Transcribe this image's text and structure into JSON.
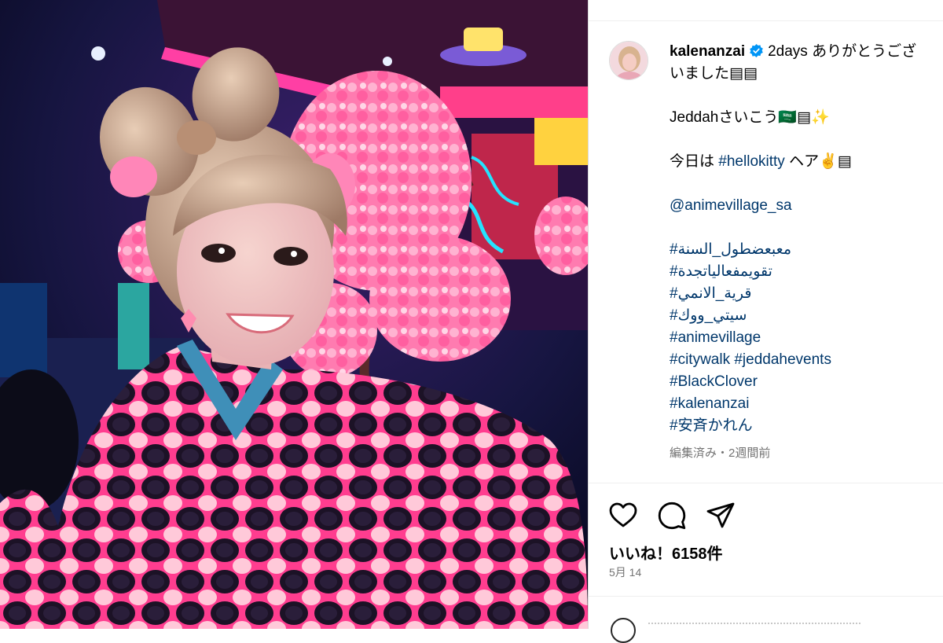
{
  "post": {
    "username": "kalenanzai",
    "caption_lines": [
      "2days ありがとうござ",
      "いました▤▤",
      "",
      "Jeddahさいこう🇸🇦▤✨",
      "",
      "今日は",
      "#hellokitty",
      "ヘア✌️▤",
      "",
      "@animevillage_sa",
      "",
      "#معبعضطول_السنة",
      "#تقويمفعالياتجدة",
      "#قرية_الانمي",
      "#سيتي_ووك",
      "#animevillage",
      "#citywalk #jeddahevents",
      "#BlackClover",
      "#kalenanzai",
      "#安斉かれん"
    ],
    "meta": "編集済み・2週間前",
    "likes": "いいね！6158件",
    "date": "5月 14"
  },
  "icons": {
    "verified": "verified-badge-icon",
    "like": "heart-icon",
    "comment": "comment-bubble-icon",
    "share": "paper-plane-icon",
    "commenter": "avatar-outline-icon"
  },
  "colors": {
    "hashtag": "#00376b",
    "verified": "#0095f6",
    "muted": "#737373"
  }
}
